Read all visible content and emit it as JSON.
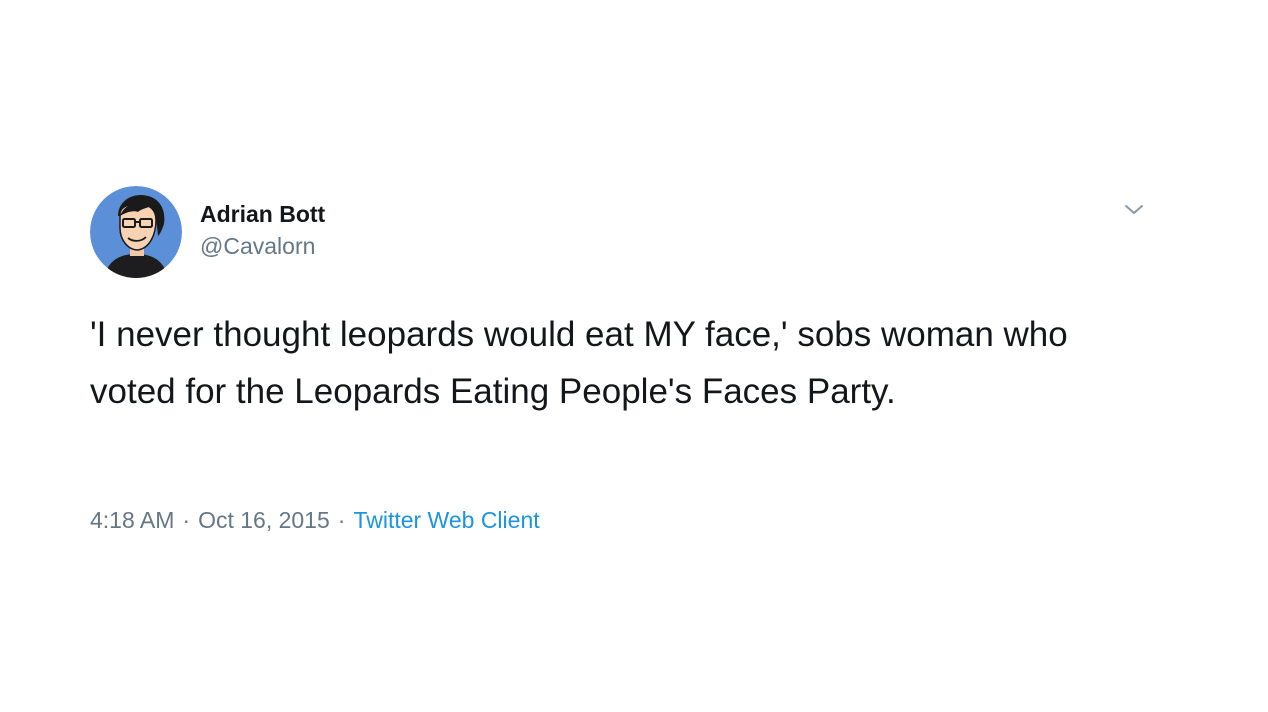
{
  "tweet": {
    "author": {
      "display_name": "Adrian Bott",
      "handle": "@Cavalorn",
      "avatar_icon": "cartoon-avatar-icon"
    },
    "menu_icon": "chevron-down-icon",
    "text": "'I never thought leopards would eat MY face,' sobs woman who voted for the Leopards Eating People's Faces Party.",
    "time": "4:18 AM",
    "separator": "·",
    "date": "Oct 16, 2015",
    "source": "Twitter Web Client"
  },
  "colors": {
    "text_primary": "#14171a",
    "text_secondary": "#657786",
    "link": "#1b95e0",
    "avatar_bg": "#5b8fd8"
  }
}
